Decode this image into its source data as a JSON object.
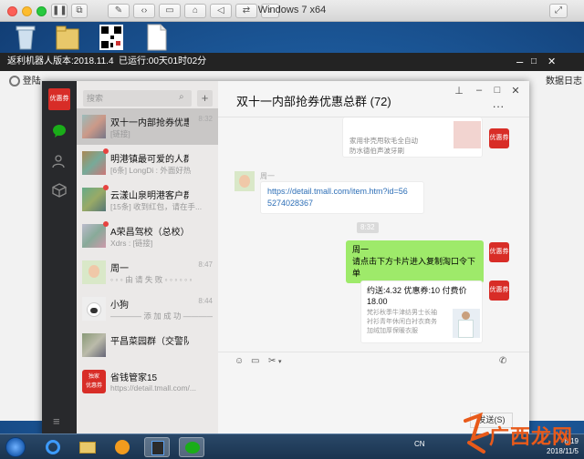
{
  "host": {
    "title": "Windows 7 x64"
  },
  "robot": {
    "bar_name": "返利机器人",
    "bar_version": "版本:2018.11.4",
    "bar_runtime": "已运行:00天01时02分",
    "tab_login": "登陆",
    "tab_log": "数据日志"
  },
  "wechat": {
    "search_placeholder": "搜索",
    "plus": "+",
    "conversations": [
      {
        "name": "双十一内部抢券优惠...",
        "preview": "[链接]",
        "time": "8:32",
        "badge": false
      },
      {
        "name": "明港镇最可爱的人群",
        "preview": "[6条] LongDi : 外面好热",
        "time": "",
        "badge": true
      },
      {
        "name": "云漾山泉明港客户群",
        "preview": "[15条] 收到红包，请在手...",
        "time": "",
        "badge": true
      },
      {
        "name": "A荣昌驾校（总校）交流群",
        "preview": "Xdrs : [链接]",
        "time": "",
        "badge": true
      },
      {
        "name": "周一",
        "preview": "◦ ◦ ◦ 由 请 失 败 ◦ ◦ ◦ ◦ ◦ ◦",
        "time": "8:47",
        "badge": false
      },
      {
        "name": "小狗",
        "preview": "———— 添 加 成 功 ————",
        "time": "8:44",
        "badge": false
      },
      {
        "name": "平昌菜园群（交警队对面）",
        "preview": "",
        "time": "",
        "badge": false
      },
      {
        "name": "省钱管家15",
        "preview": "https://detail.tmall.com/...",
        "time": "",
        "badge": false
      }
    ],
    "chat": {
      "title": "双十一内部抢券优惠总群 (72)",
      "top_card_lines": [
        "家用非壳甩软毛全自动",
        "防水德伯声波牙刷"
      ],
      "sender_name": "周一",
      "link_line1": "https://detail.tmall.com/item.htm?id=56",
      "link_line2": "5274028367",
      "timestamp": "8:32",
      "green_name": "周一",
      "green_text": "请点击下方卡片进入复制淘口令下单",
      "coupon_avatar": "优惠券",
      "card_title1": "约送:4.32 优惠券:10 付费价",
      "card_title2": "18.00",
      "card_desc": [
        "梵衫秋季牛津纺男士长袖",
        "衬衫青年休闲白衬衣商务",
        "加绒加厚保暖衣服"
      ],
      "send_label": "发送(S)"
    }
  },
  "taskbar": {
    "lang": "CN",
    "time": "8:19",
    "date": "2018/11/5"
  },
  "watermark": {
    "text": "广西龙网"
  }
}
